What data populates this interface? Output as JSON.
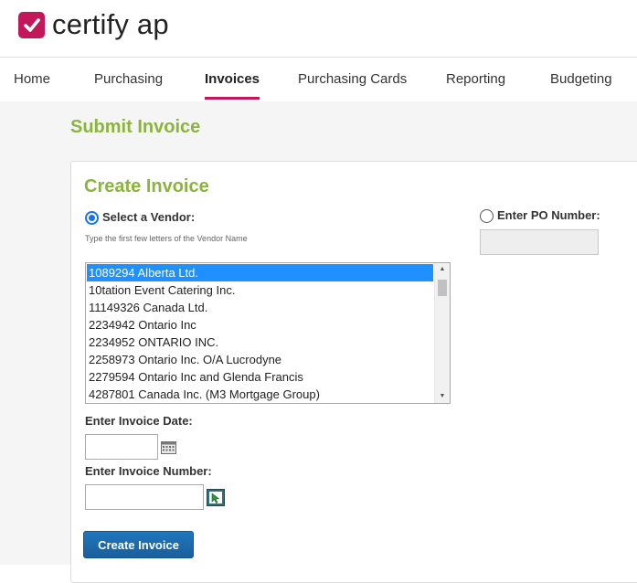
{
  "brand": {
    "logo_text": "certify ap",
    "accent_color": "#c2185b",
    "green_heading_color": "#8bb43e",
    "icon": "check-mark-icon"
  },
  "nav": {
    "items": [
      {
        "label": "Home",
        "active": false
      },
      {
        "label": "Purchasing",
        "active": false
      },
      {
        "label": "Invoices",
        "active": true
      },
      {
        "label": "Purchasing Cards",
        "active": false
      },
      {
        "label": "Reporting",
        "active": false
      },
      {
        "label": "Budgeting",
        "active": false
      }
    ]
  },
  "page": {
    "title": "Submit Invoice"
  },
  "form": {
    "title": "Create Invoice",
    "vendor_option": {
      "label": "Select a Vendor:",
      "selected": true,
      "hint": "Type the first few letters of the Vendor Name"
    },
    "po_option": {
      "label": "Enter PO Number:",
      "selected": false,
      "value": ""
    },
    "vendor_list": {
      "selected_index": 0,
      "items": [
        "1089294 Alberta Ltd.",
        "10tation Event Catering Inc.",
        "11149326 Canada Ltd.",
        "2234942 Ontario Inc",
        "2234952 ONTARIO INC.",
        "2258973 Ontario Inc. O/A Lucrodyne",
        "2279594 Ontario Inc and Glenda Francis",
        "4287801 Canada Inc. (M3 Mortgage Group)"
      ]
    },
    "invoice_date": {
      "label": "Enter Invoice Date:",
      "value": "",
      "icon": "calendar-icon"
    },
    "invoice_number": {
      "label": "Enter Invoice Number:",
      "value": "",
      "icon": "lookup-icon"
    },
    "submit_label": "Create Invoice"
  }
}
